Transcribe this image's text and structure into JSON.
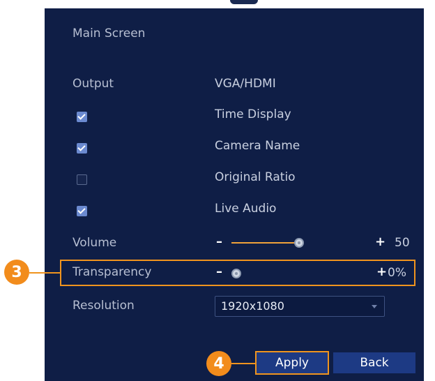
{
  "screen": {
    "title": "Main Screen"
  },
  "output": {
    "label": "Output",
    "value": "VGA/HDMI"
  },
  "checkboxes": [
    {
      "label": "Time Display",
      "checked": true
    },
    {
      "label": "Camera Name",
      "checked": true
    },
    {
      "label": "Original Ratio",
      "checked": false
    },
    {
      "label": "Live Audio",
      "checked": true
    }
  ],
  "volume": {
    "label": "Volume",
    "minus": "–",
    "plus": "+",
    "value": "50",
    "level": 0.5
  },
  "transparency": {
    "label": "Transparency",
    "minus": "–",
    "plus": "+",
    "value": "0%",
    "level": 0.0
  },
  "resolution": {
    "label": "Resolution",
    "value": "1920x1080"
  },
  "buttons": {
    "apply": "Apply",
    "back": "Back"
  },
  "callouts": {
    "step3": "3",
    "step4": "4"
  },
  "colors": {
    "panel": "#0f1e46",
    "highlight": "#f0941e",
    "button": "#1d3a84",
    "slider_fill": "#f0a23a"
  }
}
